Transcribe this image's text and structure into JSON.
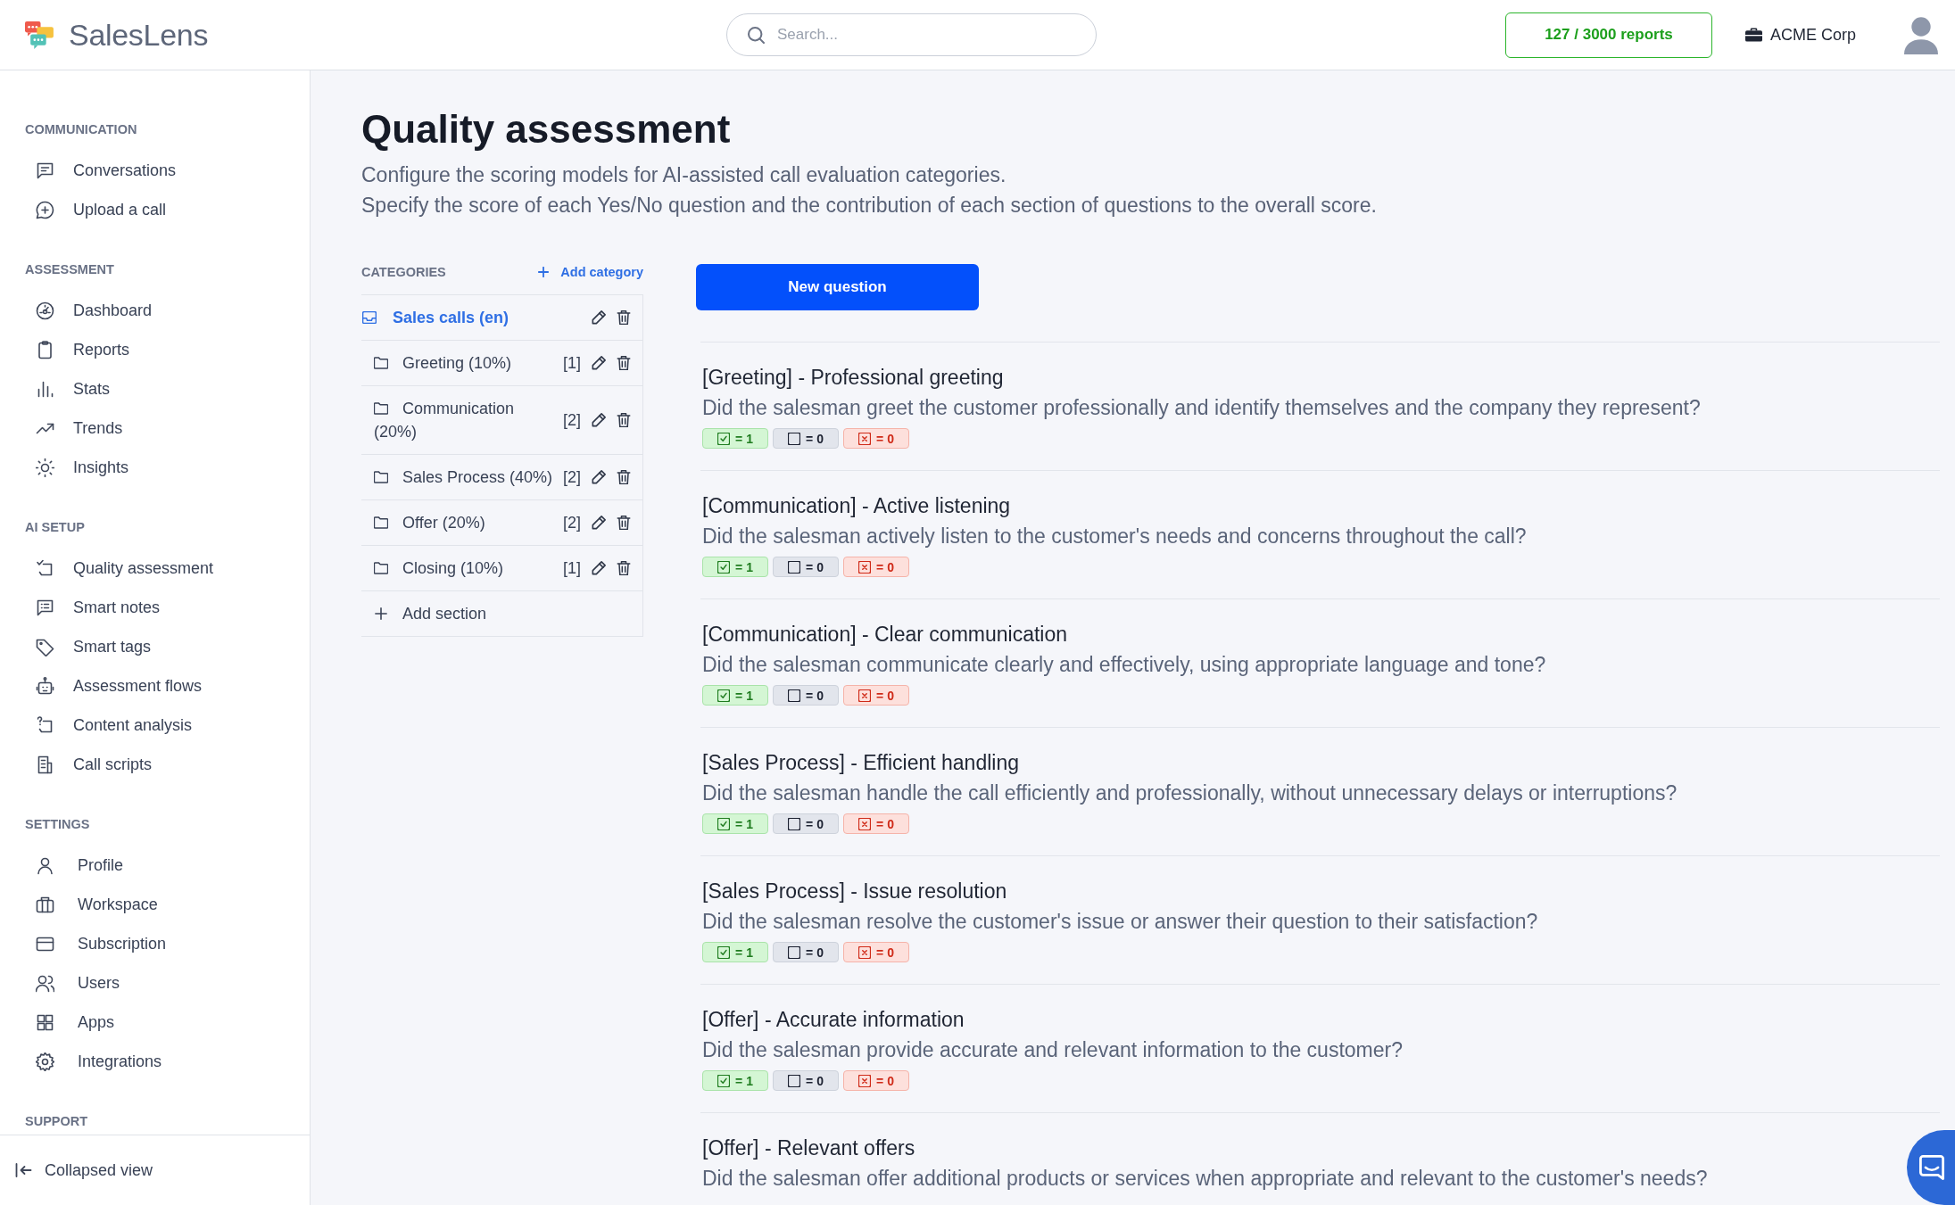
{
  "header": {
    "logo": "SalesLens",
    "search": {
      "placeholder": "Search..."
    },
    "usage": "127 / 3000 reports",
    "workspace": "ACME Corp"
  },
  "sidebar": {
    "sections": [
      {
        "title": "COMMUNICATION",
        "items": [
          {
            "label": "Conversations"
          },
          {
            "label": "Upload a call"
          }
        ]
      },
      {
        "title": "ASSESSMENT",
        "items": [
          {
            "label": "Dashboard"
          },
          {
            "label": "Reports"
          },
          {
            "label": "Stats"
          },
          {
            "label": "Trends"
          },
          {
            "label": "Insights"
          }
        ]
      },
      {
        "title": "AI SETUP",
        "items": [
          {
            "label": "Quality assessment"
          },
          {
            "label": "Smart notes"
          },
          {
            "label": "Smart tags"
          },
          {
            "label": "Assessment flows"
          },
          {
            "label": "Content analysis"
          },
          {
            "label": "Call scripts"
          }
        ]
      },
      {
        "title": "SETTINGS",
        "items": [
          {
            "label": "Profile"
          },
          {
            "label": "Workspace"
          },
          {
            "label": "Subscription"
          },
          {
            "label": "Users"
          },
          {
            "label": "Apps"
          },
          {
            "label": "Integrations"
          }
        ]
      },
      {
        "title": "SUPPORT"
      }
    ],
    "footer": "Collapsed view"
  },
  "page": {
    "title": "Quality assessment",
    "description": [
      "Configure the scoring models for AI-assisted call evaluation categories.",
      "Specify the score of each Yes/No question and the contribution of each section of questions to the overall score."
    ]
  },
  "categories": {
    "heading": "CATEGORIES",
    "add_category": "Add category",
    "items": [
      {
        "label": "Sales calls (en)",
        "selected": true,
        "children": [
          {
            "label": "Greeting (10%)",
            "count": "[1]",
            "selected": false
          },
          {
            "label": "Communication (20%)",
            "count": "[2]",
            "selected": false
          },
          {
            "label": "Sales Process (40%)",
            "count": "[2]",
            "selected": false
          },
          {
            "label": "Offer (20%)",
            "count": "[2]",
            "selected": false
          },
          {
            "label": "Closing (10%)",
            "count": "[1]",
            "selected": false
          }
        ]
      }
    ],
    "add_section": "Add section"
  },
  "new_question": "New question",
  "questions": [
    {
      "title": "[Greeting] - Professional greeting",
      "text": "Did the salesman greet the customer professionally and identify themselves and the company they represent?",
      "scores": [
        {
          "kind": "yes",
          "value": "= 1"
        },
        {
          "kind": "neutral",
          "value": "= 0"
        },
        {
          "kind": "no",
          "value": "= 0"
        }
      ]
    },
    {
      "title": "[Communication] - Active listening",
      "text": "Did the salesman actively listen to the customer's needs and concerns throughout the call?",
      "scores": [
        {
          "kind": "yes",
          "value": "= 1"
        },
        {
          "kind": "neutral",
          "value": "= 0"
        },
        {
          "kind": "no",
          "value": "= 0"
        }
      ]
    },
    {
      "title": "[Communication] - Clear communication",
      "text": "Did the salesman communicate clearly and effectively, using appropriate language and tone?",
      "scores": [
        {
          "kind": "yes",
          "value": "= 1"
        },
        {
          "kind": "neutral",
          "value": "= 0"
        },
        {
          "kind": "no",
          "value": "= 0"
        }
      ]
    },
    {
      "title": "[Sales Process] - Efficient handling",
      "text": "Did the salesman handle the call efficiently and professionally, without unnecessary delays or interruptions?",
      "scores": [
        {
          "kind": "yes",
          "value": "= 1"
        },
        {
          "kind": "neutral",
          "value": "= 0"
        },
        {
          "kind": "no",
          "value": "= 0"
        }
      ]
    },
    {
      "title": "[Sales Process] - Issue resolution",
      "text": "Did the salesman resolve the customer's issue or answer their question to their satisfaction?",
      "scores": [
        {
          "kind": "yes",
          "value": "= 1"
        },
        {
          "kind": "neutral",
          "value": "= 0"
        },
        {
          "kind": "no",
          "value": "= 0"
        }
      ]
    },
    {
      "title": "[Offer] - Accurate information",
      "text": "Did the salesman provide accurate and relevant information to the customer?",
      "scores": [
        {
          "kind": "yes",
          "value": "= 1"
        },
        {
          "kind": "neutral",
          "value": "= 0"
        },
        {
          "kind": "no",
          "value": "= 0"
        }
      ]
    },
    {
      "title": "[Offer] - Relevant offers",
      "text": "Did the salesman offer additional products or services when appropriate and relevant to the customer's needs?"
    }
  ]
}
